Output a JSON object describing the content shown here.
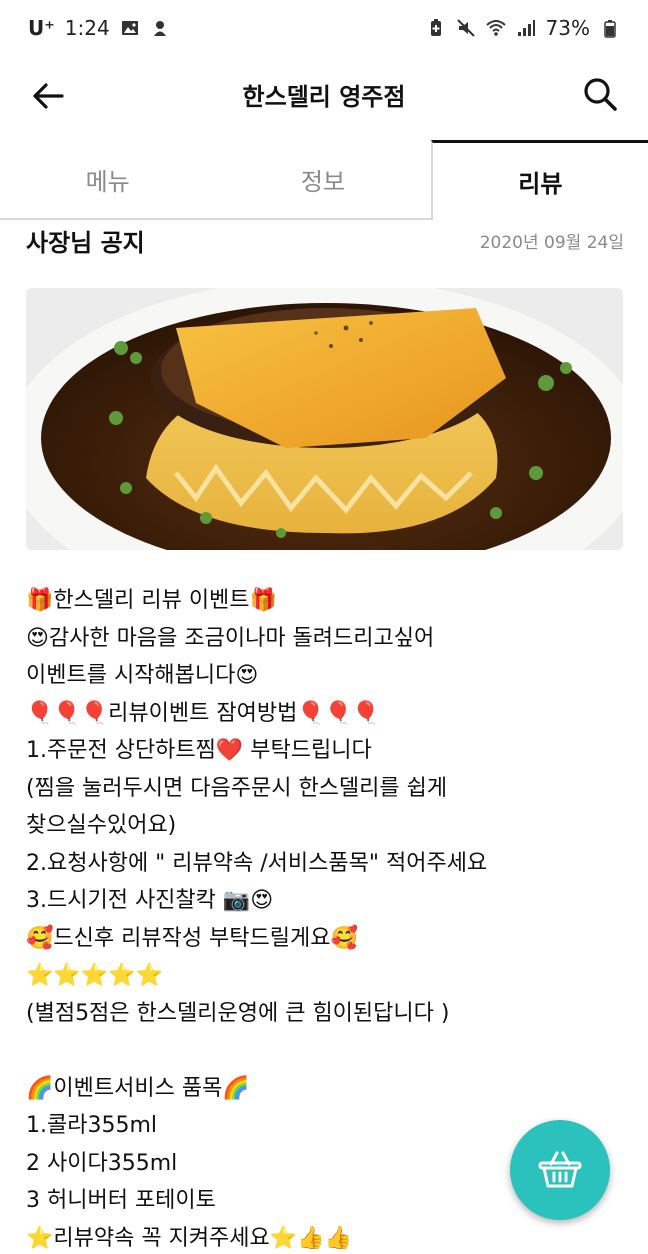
{
  "status_bar": {
    "carrier": "U⁺",
    "time": "1:24",
    "battery": "73%"
  },
  "app_bar": {
    "title": "한스델리 영주점"
  },
  "tabs": [
    {
      "label": "메뉴"
    },
    {
      "label": "정보"
    },
    {
      "label": "리뷰"
    }
  ],
  "notice": {
    "title": "사장님 공지",
    "date": "2020년 09월 24일"
  },
  "content_lines": [
    "🎁한스델리 리뷰 이벤트🎁",
    "😍감사한  마음을 조금이나마 돌려드리고싶어",
    "이벤트를  시작해봅니다😍",
    "🎈🎈🎈리뷰이벤트  잠여방법🎈🎈🎈",
    "1.주문전  상단하트찜❤️ 부탁드립니다",
    "(찜을 눌러두시면 다음주문시  한스델리를 쉽게",
    "찾으실수있어요)",
    "2.요청사항에  \" 리뷰약속 /서비스품목\" 적어주세요",
    "3.드시기전  사진찰칵 📷😍",
    "🥰드신후 리뷰작성 부탁드릴게요🥰",
    "⭐⭐⭐⭐⭐",
    "(별점5점은 한스델리운영에  큰 힘이된답니다 )",
    "",
    "🌈이벤트서비스 품목🌈",
    "1.콜라355ml",
    "2 사이다355ml",
    "3 허니버터 포테이토",
    "⭐리뷰약속  꼭 지켜주세요⭐👍👍"
  ],
  "colors": {
    "accent": "#2bc1bd",
    "muted_text": "#8a8a8a"
  }
}
